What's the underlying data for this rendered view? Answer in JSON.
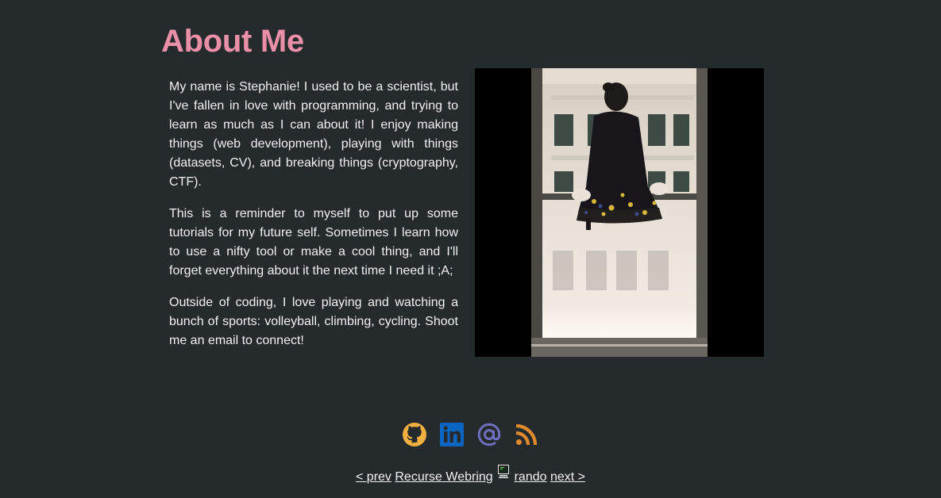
{
  "page": {
    "title": "About Me"
  },
  "bio": {
    "paragraphs": [
      "My name is Stephanie! I used to be a scientist, but I've fallen in love with programming, and trying to learn as much as I can about it! I enjoy making things (web development), playing with things (datasets, CV), and breaking things (cryptography, CTF).",
      "This is a reminder to myself to put up some tutorials for my future self. Sometimes I learn how to use a nifty tool or make a cool thing, and I'll forget everything about it the next time I need it ;A;",
      "Outside of coding, I love playing and watching a bunch of sports: volleyball, climbing, cycling. Shoot me an email to connect!"
    ]
  },
  "social": {
    "icons": [
      "github-icon",
      "linkedin-icon",
      "email-at-icon",
      "rss-icon"
    ],
    "colors": {
      "github": "#f2b040",
      "linkedin": "#0a66c2",
      "email": "#6f6fbf",
      "rss": "#e08a2c"
    }
  },
  "webring": {
    "prev_label": "< prev",
    "ring_label": "Recurse Webring",
    "rando_label": "rando",
    "next_label": "next >",
    "ring_icon": "recurse-center-icon"
  },
  "colors": {
    "background": "#252a2c",
    "title": "#e98fa8",
    "text": "#f2f2f2"
  }
}
